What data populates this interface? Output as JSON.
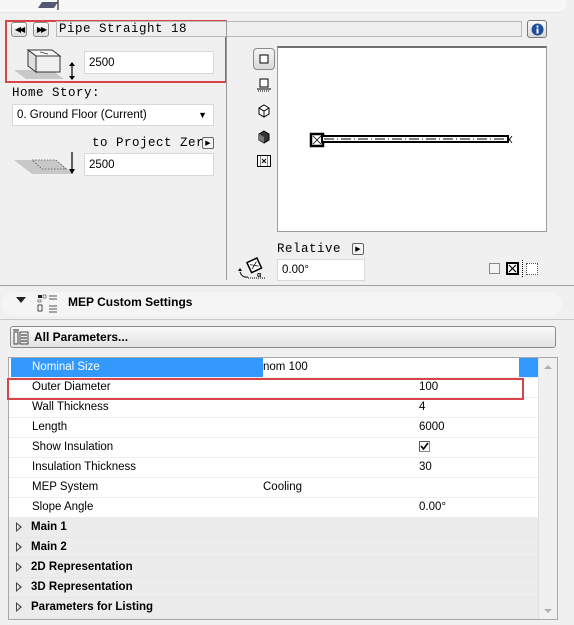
{
  "header": {
    "element_name": "Pipe Straight 18",
    "prev_label": "◀◀",
    "next_label": "▶▶",
    "info_icon": "info-icon"
  },
  "geometry": {
    "height_value": "2500",
    "home_story_label": "Home Story:",
    "home_story_selected": "0. Ground Floor (Current)",
    "offset_label": "to Project Zero",
    "offset_value": "2500"
  },
  "preview": {
    "view_buttons": [
      "plan-view",
      "section-view",
      "3d-wire-view",
      "3d-shaded-view",
      "film-view"
    ],
    "rotation_mode_label": "Relative",
    "rotation_value": "0.00°"
  },
  "mep_section": {
    "title": "MEP Custom Settings",
    "all_params_label": "All Parameters..."
  },
  "params": {
    "rows": [
      {
        "name": "Nominal Size",
        "value": "nom 100",
        "selected": true
      },
      {
        "name": "Outer Diameter",
        "value": "100"
      },
      {
        "name": "Wall Thickness",
        "value": "4"
      },
      {
        "name": "Length",
        "value": "6000"
      },
      {
        "name": "Show Insulation",
        "value": "checked"
      },
      {
        "name": "Insulation Thickness",
        "value": "30"
      },
      {
        "name": "MEP System",
        "value": "Cooling"
      },
      {
        "name": "Slope Angle",
        "value": "0.00°"
      }
    ],
    "groups": [
      "Main 1",
      "Main 2",
      "2D Representation",
      "3D Representation",
      "Parameters for Listing"
    ]
  },
  "colors": {
    "selection": "#3399ff",
    "highlight_box": "#d9434a",
    "info_blue": "#1f4f9c"
  }
}
